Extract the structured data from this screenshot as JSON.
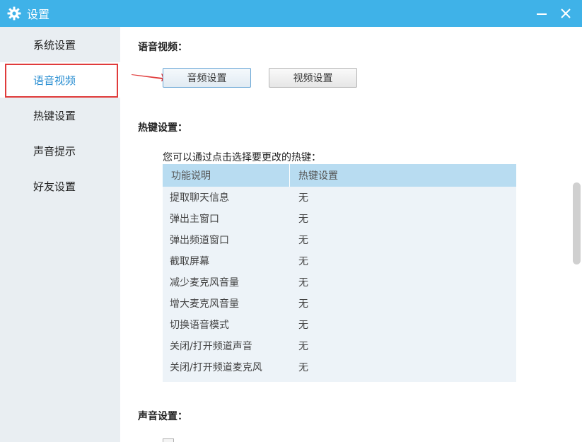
{
  "window": {
    "title": "设置",
    "minimize_glyph": "—",
    "close_glyph": "✕"
  },
  "sidebar": {
    "items": [
      {
        "label": "系统设置",
        "active": false
      },
      {
        "label": "语音视频",
        "active": true
      },
      {
        "label": "热键设置",
        "active": false
      },
      {
        "label": "声音提示",
        "active": false
      },
      {
        "label": "好友设置",
        "active": false
      }
    ]
  },
  "voice_video": {
    "section_title": "语音视频：",
    "audio_button": "音频设置",
    "video_button": "视频设置"
  },
  "hotkeys": {
    "section_title": "热键设置：",
    "hint": "您可以通过点击选择要更改的热键：",
    "columns": [
      "功能说明",
      "热键设置"
    ],
    "rows": [
      [
        "提取聊天信息",
        "无"
      ],
      [
        "弹出主窗口",
        "无"
      ],
      [
        "弹出频道窗口",
        "无"
      ],
      [
        "截取屏幕",
        "无"
      ],
      [
        "减少麦克风音量",
        "无"
      ],
      [
        "增大麦克风音量",
        "无"
      ],
      [
        "切换语音模式",
        "无"
      ],
      [
        "关闭/打开频道声音",
        "无"
      ],
      [
        "关闭/打开频道麦克风",
        "无"
      ]
    ]
  },
  "sound": {
    "section_title": "声音设置："
  },
  "colors": {
    "titlebar": "#3fb2e8",
    "active_text": "#2b8fd2",
    "highlight_border": "#e03b3b",
    "table_header": "#b8dcf1"
  }
}
